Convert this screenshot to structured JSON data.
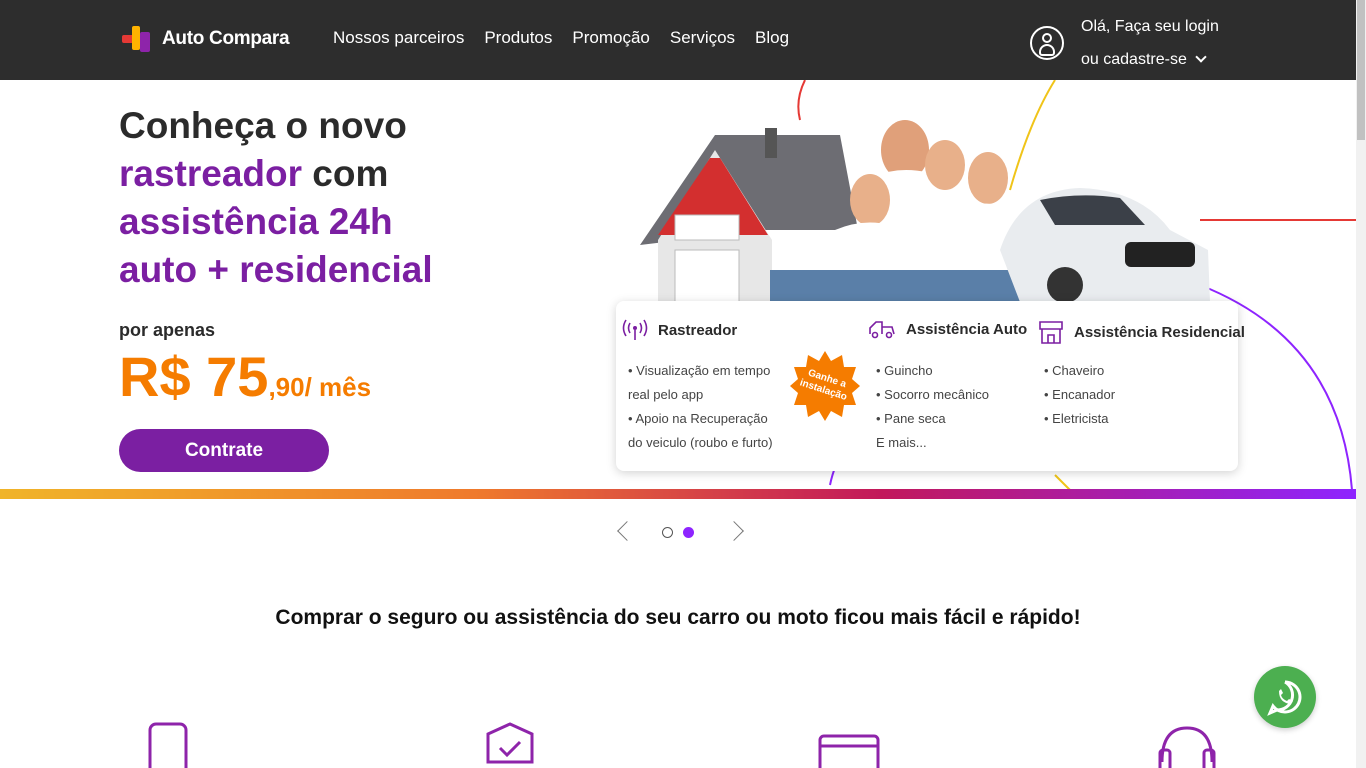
{
  "header": {
    "logo_text": "Auto Compara",
    "nav": [
      "Nossos parceiros",
      "Produtos",
      "Promoção",
      "Serviços",
      "Blog"
    ],
    "account_line1": "Olá, Faça seu login",
    "account_line2": "ou cadastre-se"
  },
  "hero": {
    "title_line1": "Conheça o novo",
    "title_line2_accent": "rastreador",
    "title_line2_rest": " com",
    "title_line3": "assistência 24h",
    "title_line4": "auto + residencial",
    "por_apenas": "por apenas",
    "price_main": "R$ 75",
    "price_cents": ",90/ mês",
    "cta": "Contrate"
  },
  "card": {
    "badge": "Ganhe a instalação",
    "columns": [
      {
        "title": "Rastreador",
        "icon": "signal-tower-icon",
        "items": [
          "• Visualização em tempo",
          "real pelo app",
          "• Apoio na Recuperação",
          "do veiculo (roubo e furto)"
        ]
      },
      {
        "title": "Assistência Auto",
        "icon": "tow-truck-icon",
        "items": [
          "• Guincho",
          "• Socorro mecânico",
          "• Pane seca",
          "E mais..."
        ]
      },
      {
        "title": "Assistência Residencial",
        "icon": "house-icon",
        "items": [
          "• Chaveiro",
          "• Encanador",
          "• Eletricista"
        ]
      }
    ]
  },
  "carousel": {
    "total": 2,
    "active": 2
  },
  "section": {
    "title": "Comprar o seguro ou assistência do seu carro ou moto ficou mais fácil e rápido!"
  },
  "colors": {
    "header_bg": "#2d2d2d",
    "purple": "#7b1fa2",
    "orange": "#f57c00",
    "whatsapp": "#4caf50"
  },
  "features": [
    "phone-icon",
    "shield-check-icon",
    "card-icon",
    "headset-icon"
  ]
}
